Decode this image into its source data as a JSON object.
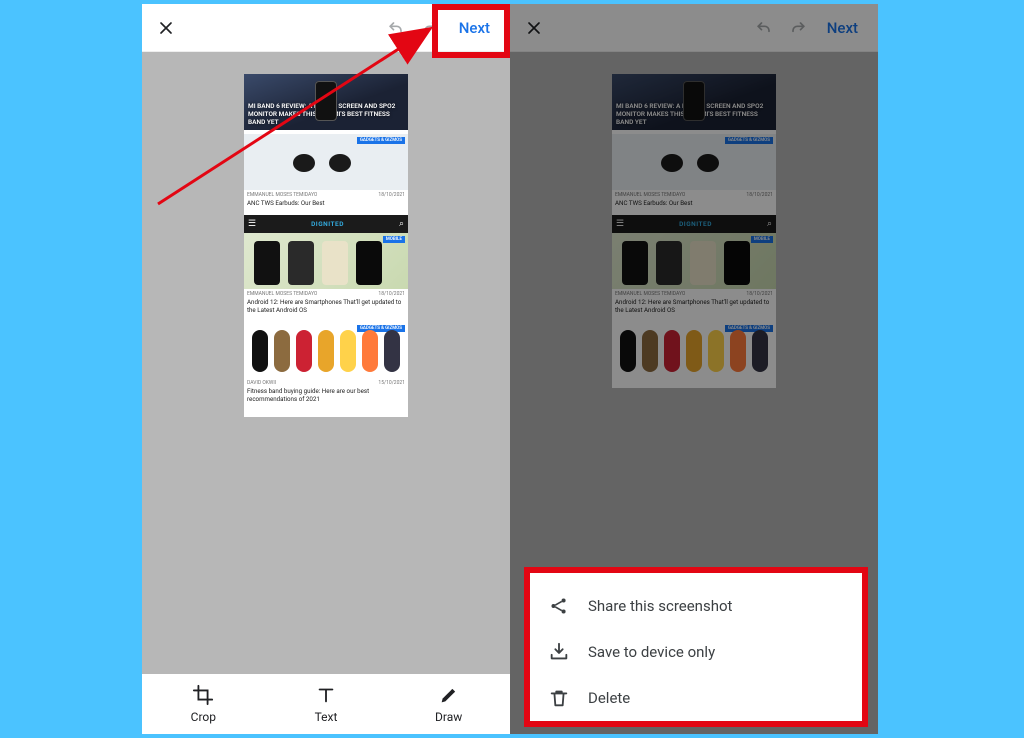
{
  "topbar": {
    "next_label": "Next"
  },
  "bottombar": {
    "crop": "Crop",
    "text": "Text",
    "draw": "Draw"
  },
  "articles": {
    "a1_title": "MI BAND 6 REVIEW: A BIGGER SCREEN AND SPO2 MONITOR MAKES THIS XIAOMI'S BEST FITNESS BAND YET",
    "badge_gadgets": "GADGETS & GIZMOS",
    "badge_mobile": "MOBILE",
    "author": "EMMANUEL MOSES TEMIDAYO",
    "date": "18/10/2021",
    "a2_title": "ANC TWS Earbuds: Our Best",
    "site_brand": "DIGNITED",
    "a3_title": "Android 12: Here are Smartphones That'll get updated to the Latest Android OS",
    "a4_author": "DAVID OKWII",
    "a4_date": "15/10/2021",
    "a4_title": "Fitness band buying guide: Here are our best recommendations of 2021"
  },
  "sheet": {
    "share": "Share this screenshot",
    "save": "Save to device only",
    "delete": "Delete"
  }
}
